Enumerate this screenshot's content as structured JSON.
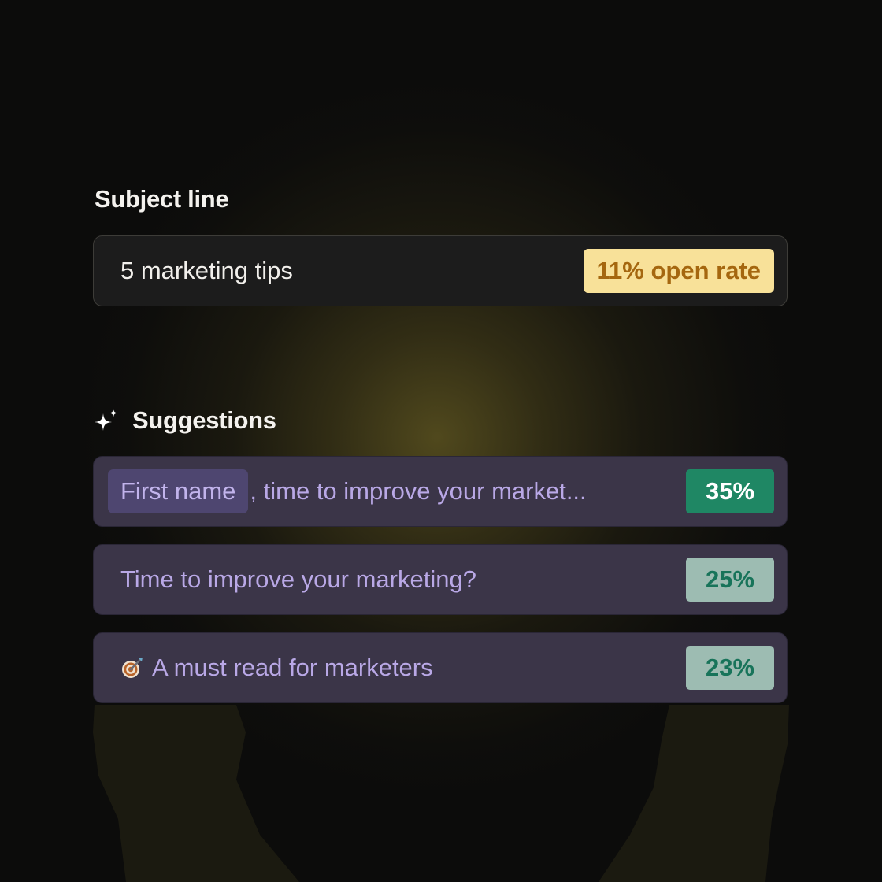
{
  "subject": {
    "label": "Subject line",
    "value": "5 marketing tips",
    "open_rate": "11% open rate"
  },
  "suggestions": {
    "label": "Suggestions",
    "items": [
      {
        "token": "First name",
        "text": ", time to improve your market...",
        "rate": "35%"
      },
      {
        "text": "Time to improve your marketing?",
        "rate": "25%"
      },
      {
        "icon": "dart-icon",
        "text": "A must read for marketers",
        "rate": "23%"
      }
    ]
  },
  "colors": {
    "background": "#0c0c0b",
    "glow": "#544c1e",
    "open_rate_badge": "#f8e199",
    "open_rate_text": "#a5670f",
    "suggestion_row": "#3b3548",
    "suggestion_text": "#b9a8e6",
    "rate_high": "#1f8764",
    "rate_mid": "#9dbcb2"
  }
}
